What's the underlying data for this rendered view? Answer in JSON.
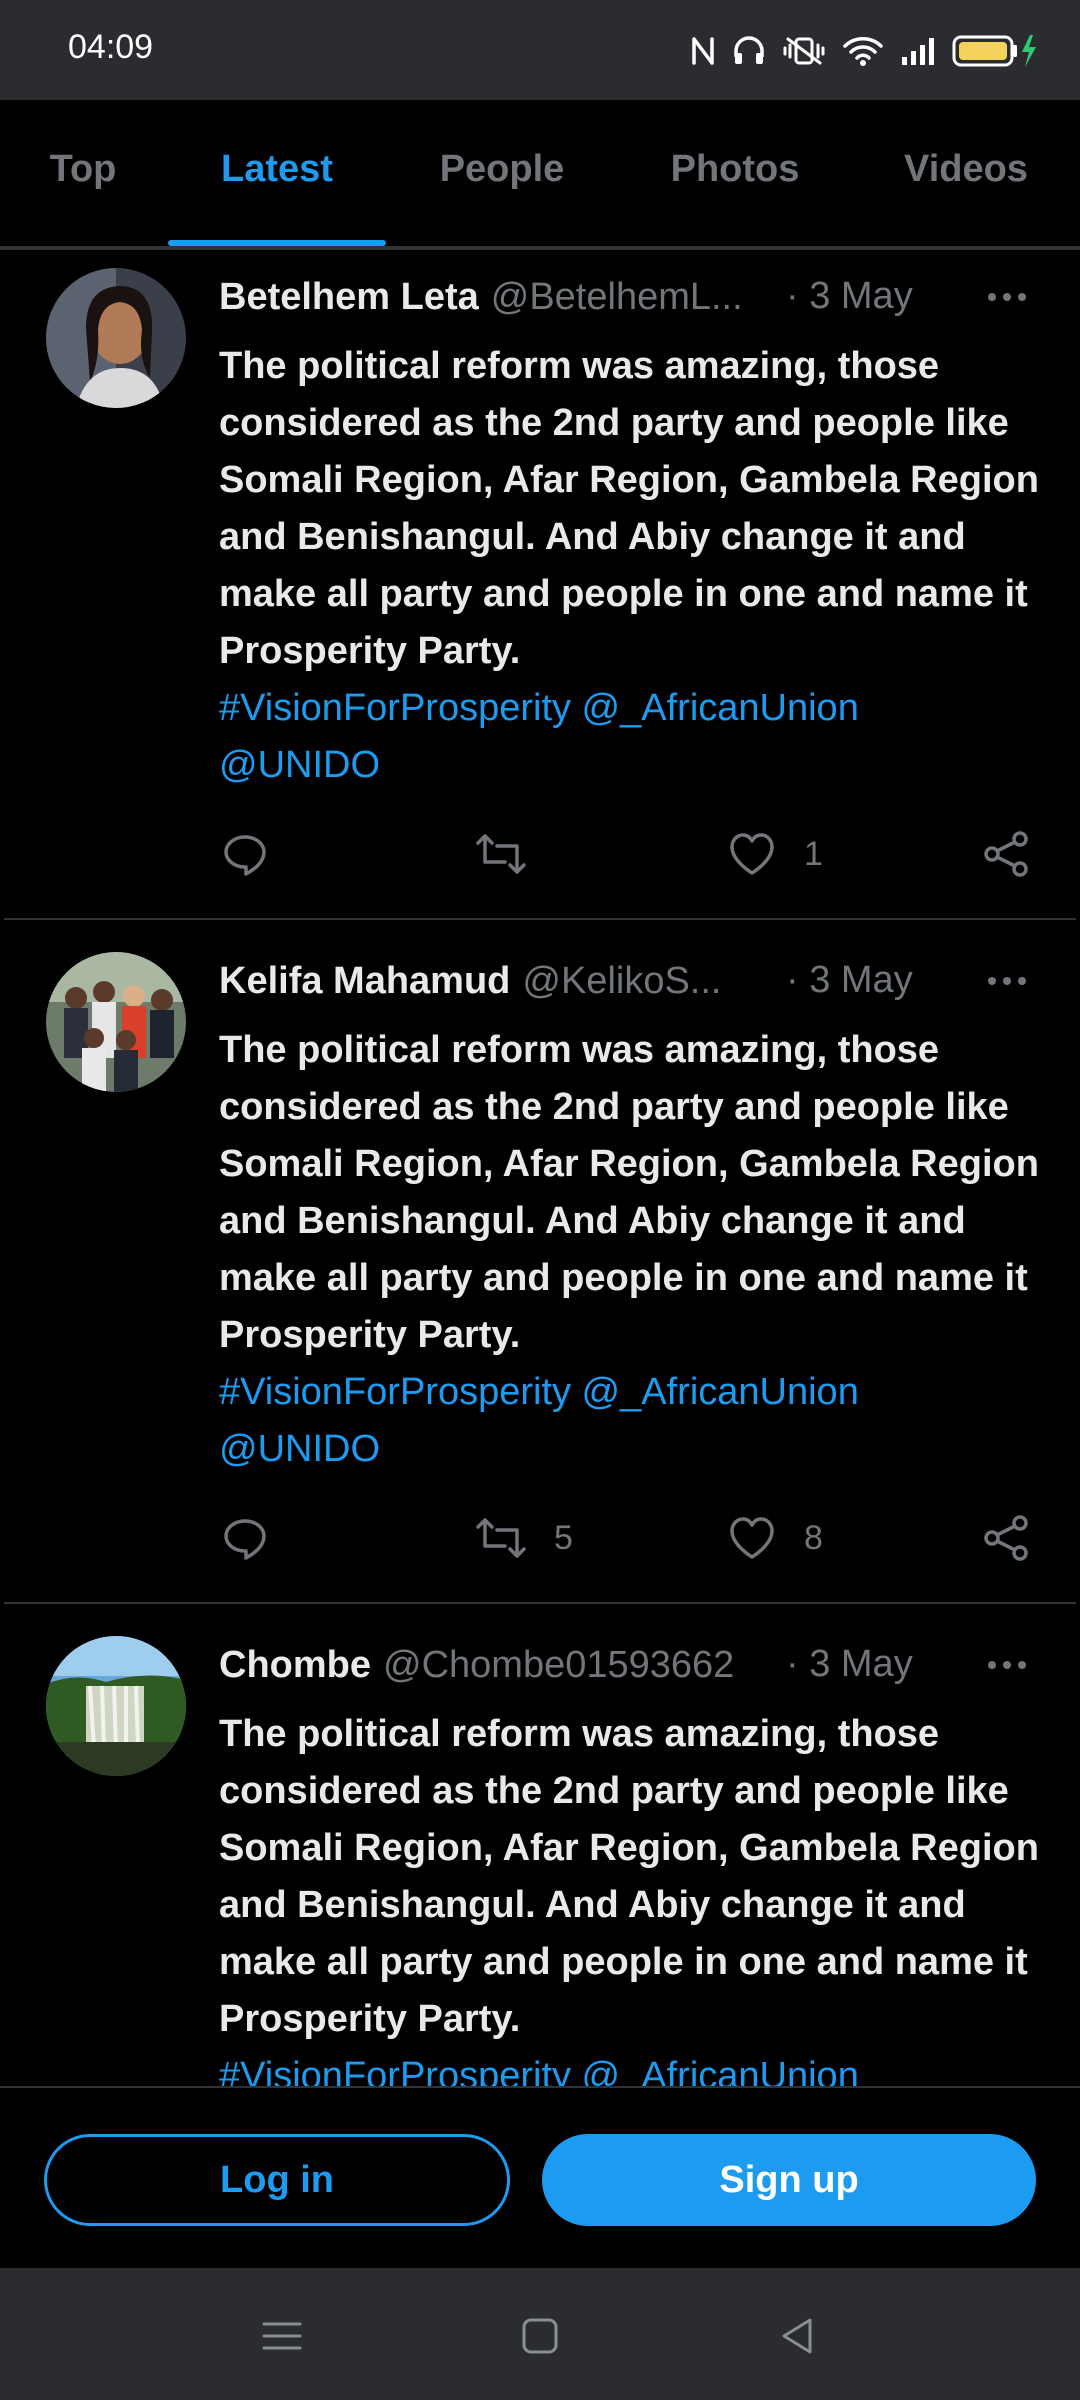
{
  "status_bar": {
    "time": "04:09",
    "icons": [
      "nfc-icon",
      "headphones-icon",
      "vibrate-icon",
      "wifi-icon",
      "signal-icon",
      "battery-charging-icon"
    ]
  },
  "tabs": [
    {
      "label": "Top",
      "active": false
    },
    {
      "label": "Latest",
      "active": true
    },
    {
      "label": "People",
      "active": false
    },
    {
      "label": "Photos",
      "active": false
    },
    {
      "label": "Videos",
      "active": false
    }
  ],
  "tweets": [
    {
      "name": "Betelhem Leta",
      "handle": "@BetelhemL...",
      "date": "· 3 May",
      "text": "The political reform was amazing, those considered as the 2nd party and people like Somali Region, Afar Region, Gambela Region and Benishangul. And Abiy change it and make all party and people in one and name it Prosperity Party.",
      "links_line1": "#VisionForProsperity @_AfricanUnion",
      "links_line2": "@UNIDO",
      "reply_count": "",
      "retweet_count": "",
      "like_count": "1"
    },
    {
      "name": "Kelifa Mahamud",
      "handle": "@KelikoS...",
      "date": "· 3 May",
      "text": "The political reform was amazing, those considered as the 2nd party and people like Somali Region, Afar Region, Gambela Region and Benishangul. And Abiy change it and make all party and people in one and name it Prosperity Party.",
      "links_line1": "#VisionForProsperity @_AfricanUnion",
      "links_line2": "@UNIDO",
      "reply_count": "",
      "retweet_count": "5",
      "like_count": "8"
    },
    {
      "name": "Chombe",
      "handle": "@Chombe01593662",
      "date": "· 3 May",
      "text": "The political reform was amazing, those considered as the 2nd party and people like Somali Region, Afar Region, Gambela Region and Benishangul. And Abiy change it and make all party and people in one and name it Prosperity Party.",
      "links_line1": "#VisionForProsperity @_AfricanUnion",
      "links_line2": ""
    }
  ],
  "auth": {
    "login_label": "Log in",
    "signup_label": "Sign up"
  },
  "colors": {
    "accent": "#1d9bf0",
    "background": "#000000",
    "muted_text": "#71767b",
    "system_bar": "#2a2c2f"
  }
}
